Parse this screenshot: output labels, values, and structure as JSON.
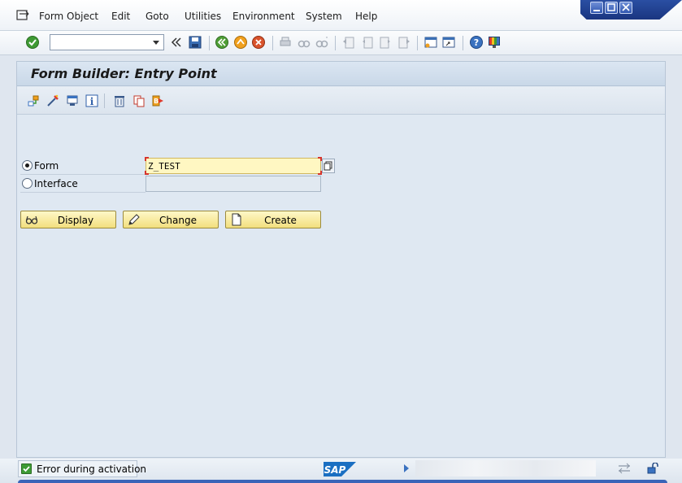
{
  "menubar": {
    "items": [
      {
        "label": "Form Object"
      },
      {
        "label": "Edit"
      },
      {
        "label": "Goto"
      },
      {
        "label": "Utilities"
      },
      {
        "label": "Environment"
      },
      {
        "label": "System"
      },
      {
        "label": "Help"
      }
    ]
  },
  "toolbar": {
    "command_value": "",
    "icons": [
      "enter-icon",
      "save-icon",
      "back-icon",
      "exit-icon",
      "cancel-icon",
      "print-icon",
      "find-icon",
      "find-next-icon",
      "first-page-icon",
      "previous-page-icon",
      "next-page-icon",
      "last-page-icon",
      "create-session-icon",
      "shortcut-icon",
      "help-icon",
      "layout-menu-icon"
    ]
  },
  "page": {
    "title": "Form Builder: Entry Point"
  },
  "app_toolbar": {
    "icons": [
      "other-object-icon",
      "test-icon",
      "activate-icon",
      "info-icon",
      "delete-icon",
      "copy-icon",
      "rename-icon"
    ]
  },
  "form": {
    "radio_form_label": "Form",
    "radio_form_checked": true,
    "form_value": "Z_TEST",
    "radio_interface_label": "Interface",
    "radio_interface_checked": false,
    "interface_value": ""
  },
  "buttons": {
    "display_label": "Display",
    "change_label": "Change",
    "create_label": "Create"
  },
  "status": {
    "message": "Error during activation",
    "logo_text": "SAP"
  },
  "colors": {
    "button_fill": "#f2df7e",
    "input_highlight": "#fff7c2",
    "title_bar": "#c9d8e8",
    "status_ok": "#3d9b35"
  }
}
